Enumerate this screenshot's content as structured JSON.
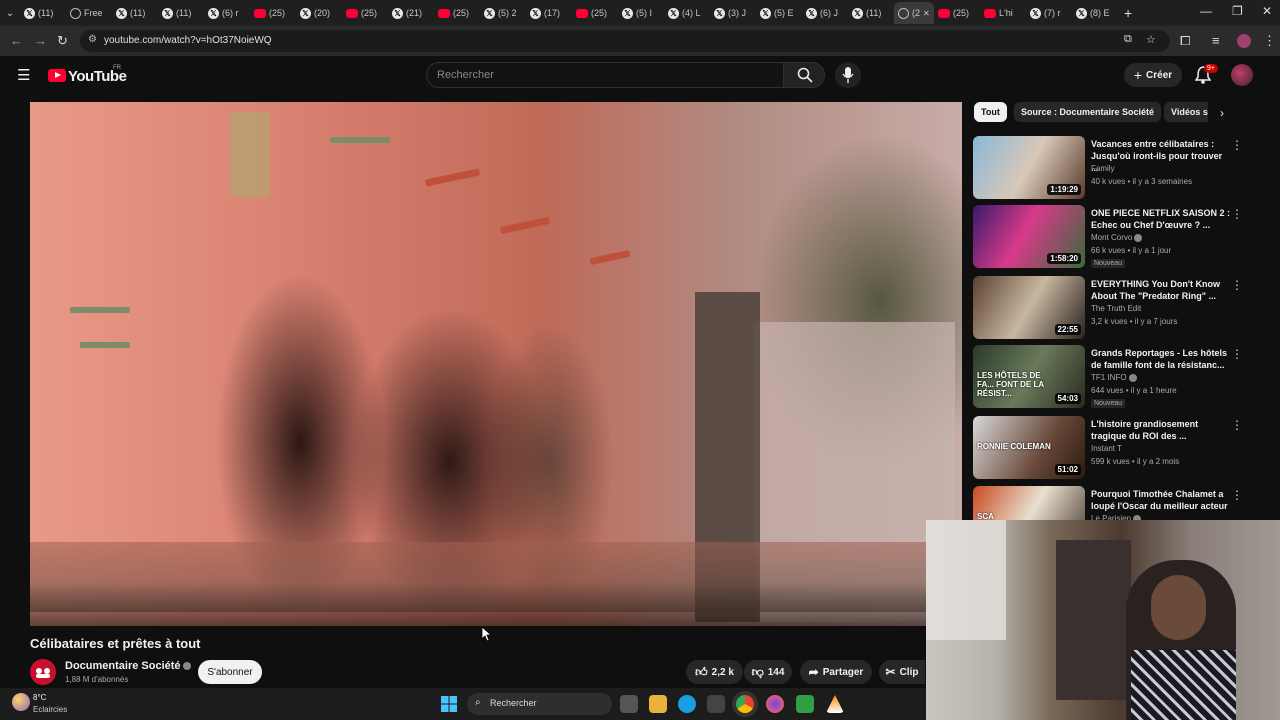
{
  "browser": {
    "tabs": [
      {
        "title": "(11)",
        "icon": "x"
      },
      {
        "title": "Free",
        "icon": "o"
      },
      {
        "title": "(11)",
        "icon": "x"
      },
      {
        "title": "(11)",
        "icon": "x"
      },
      {
        "title": "(6) r",
        "icon": "x"
      },
      {
        "title": "(25)",
        "icon": "yt"
      },
      {
        "title": "(20)",
        "icon": "x"
      },
      {
        "title": "(25)",
        "icon": "yt"
      },
      {
        "title": "(21)",
        "icon": "x"
      },
      {
        "title": "(25)",
        "icon": "yt"
      },
      {
        "title": "(5) 2",
        "icon": "x"
      },
      {
        "title": "(17)",
        "icon": "x"
      },
      {
        "title": "(25)",
        "icon": "yt"
      },
      {
        "title": "(5) I",
        "icon": "x"
      },
      {
        "title": "(4) L",
        "icon": "x"
      },
      {
        "title": "(3) J",
        "icon": "x"
      },
      {
        "title": "(5) E",
        "icon": "x"
      },
      {
        "title": "(6) J",
        "icon": "x"
      },
      {
        "title": "(11)",
        "icon": "x"
      },
      {
        "title": "(2",
        "icon": "o",
        "active": true
      },
      {
        "title": "(25)",
        "icon": "yt"
      },
      {
        "title": "L'hi",
        "icon": "yt"
      },
      {
        "title": "(7) r",
        "icon": "x"
      },
      {
        "title": "(8) E",
        "icon": "x"
      }
    ],
    "url": "youtube.com/watch?v=hOt37NoieWQ"
  },
  "youtube": {
    "logo": "YouTube",
    "logo_region": "FR",
    "search_placeholder": "Rechercher",
    "create_label": "Créer",
    "notif_badge": "9+"
  },
  "video": {
    "title": "Célibataires et prêtes à tout",
    "channel": "Documentaire Société",
    "subscribers": "1,88 M d'abonnés",
    "subscribe_label": "S'abonner",
    "likes": "2,2 k",
    "dislikes": "144",
    "share_label": "Partager",
    "clip_label": "Clip"
  },
  "chips": [
    "Tout",
    "Source : Documentaire Société",
    "Vidéos s"
  ],
  "recommendations": [
    {
      "title": "Vacances entre célibataires : Jusqu'où iront-ils pour trouver ...",
      "channel": "Family",
      "meta": "40 k vues • il y a 3 semaines",
      "duration": "1:19:29",
      "verified": false,
      "badge": ""
    },
    {
      "title": "ONE PIECE NETFLIX SAISON 2 : Echec ou Chef D'œuvre ? ...",
      "channel": "Mont Corvo",
      "meta": "66 k vues • il y a 1 jour",
      "duration": "1:58:20",
      "verified": true,
      "badge": "Nouveau"
    },
    {
      "title": "EVERYTHING You Don't Know About The \"Predator Ring\" ...",
      "channel": "The Truth Edit",
      "meta": "3,2 k vues • il y a 7 jours",
      "duration": "22:55",
      "verified": false,
      "badge": ""
    },
    {
      "title": "Grands Reportages - Les hôtels de famille font de la résistanc...",
      "channel": "TF1 INFO",
      "meta": "644 vues • il y a 1 heure",
      "duration": "54:03",
      "verified": true,
      "badge": "Nouveau"
    },
    {
      "title": "L'histoire grandiosement tragique du ROI des ...",
      "channel": "Instant T",
      "meta": "599 k vues • il y a 2 mois",
      "duration": "51:02",
      "verified": false,
      "badge": ""
    },
    {
      "title": "Pourquoi Timothée Chalamet a loupé l'Oscar du meilleur acteur",
      "channel": "Le Parisien",
      "meta": "",
      "duration": "",
      "verified": true,
      "badge": ""
    }
  ],
  "thumb_texts": [
    "",
    "",
    "",
    "LES HÔTELS DE FA... FONT DE LA RÉSIST...",
    "RONNIE COLEMAN",
    "SCA"
  ],
  "taskbar": {
    "weather_temp": "8°C",
    "weather_desc": "Eclaircies",
    "search_label": "Rechercher"
  },
  "colors": {
    "background": "#0f0f0f",
    "accent": "#ff0033"
  }
}
